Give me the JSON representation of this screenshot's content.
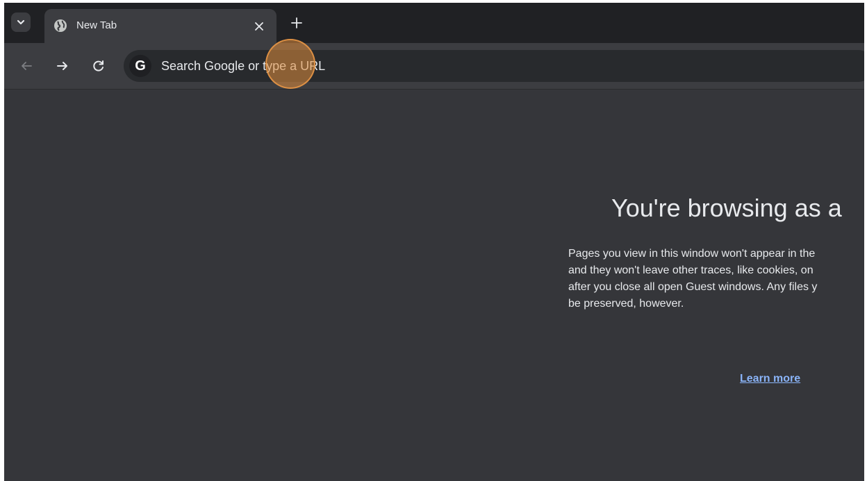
{
  "tabs": [
    {
      "title": "New Tab",
      "icon": "globe-icon"
    }
  ],
  "toolbar": {
    "omnibox_placeholder": "Search Google or type a URL",
    "search_badge": "G"
  },
  "content": {
    "heading": "You're browsing as a",
    "paragraph_lines": [
      "Pages you view in this window won't appear in the",
      "and they won't leave other traces, like cookies, on",
      "after you close all open Guest windows. Any files y",
      "be preserved, however."
    ],
    "learn_more": "Learn more"
  },
  "colors": {
    "accent_link": "#8ab4f8",
    "click_ring": "#de8c3c",
    "background": "#35363a"
  }
}
